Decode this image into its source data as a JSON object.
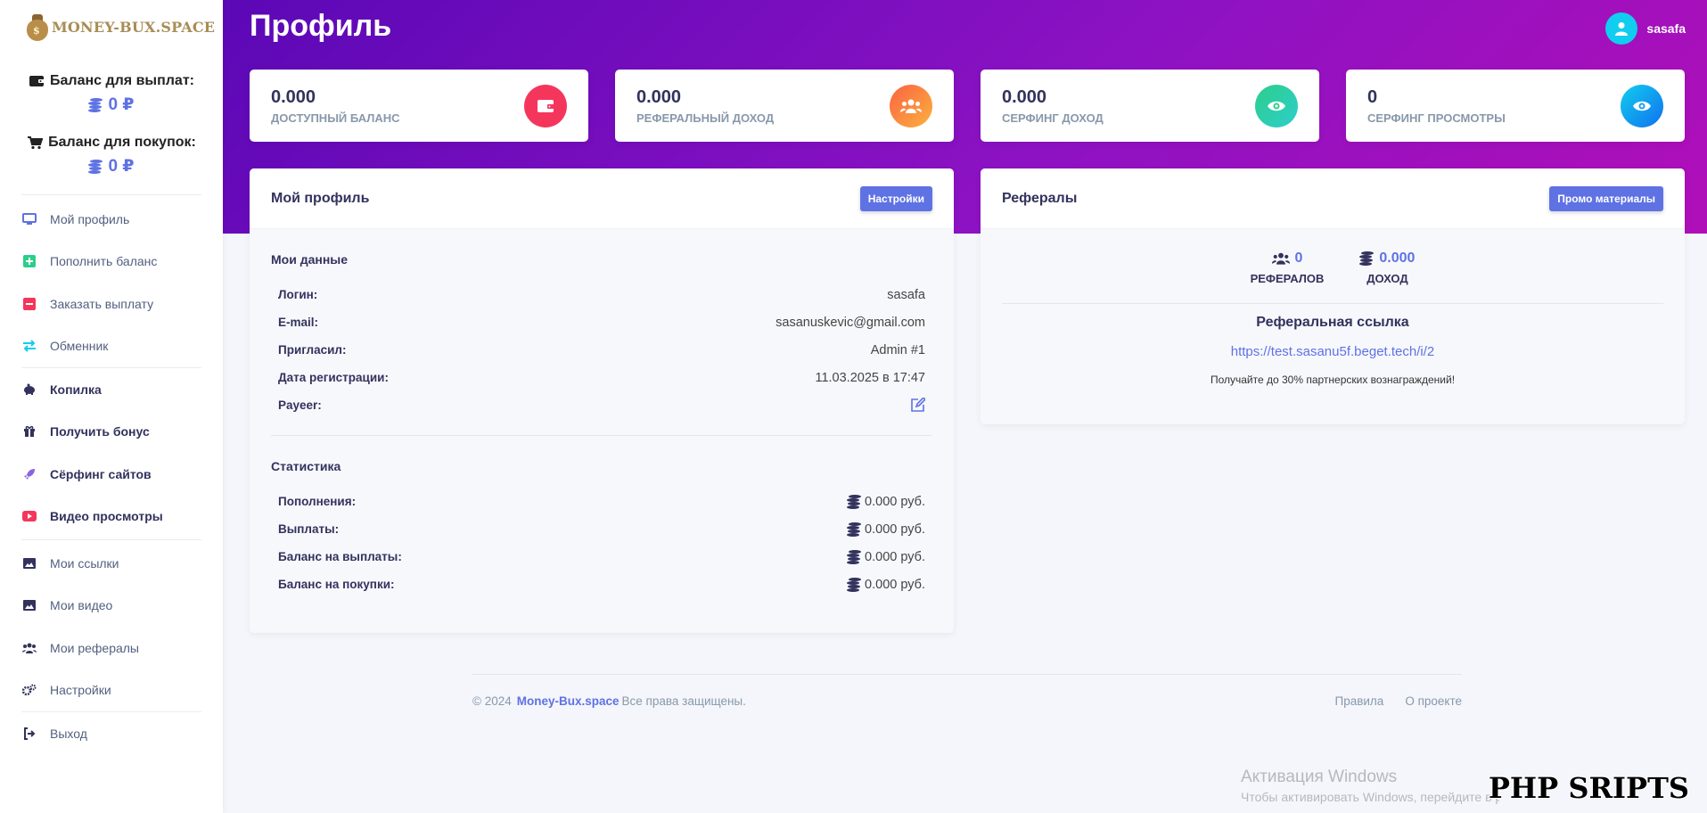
{
  "sidebar": {
    "logo_text": "MONEY-BUX.SPACE",
    "logo_mark": "$",
    "payout_balance_label": "Баланс для выплат:",
    "payout_balance_value": "0 ₽",
    "purchase_balance_label": "Баланс для покупок:",
    "purchase_balance_value": "0 ₽",
    "nav_group1": [
      {
        "label": "Мой профиль",
        "icon": "monitor-icon"
      },
      {
        "label": "Пополнить баланс",
        "icon": "plus-square-icon"
      },
      {
        "label": "Заказать выплату",
        "icon": "minus-square-icon"
      },
      {
        "label": "Обменник",
        "icon": "exchange-icon"
      }
    ],
    "nav_group2": [
      {
        "label": "Копилка",
        "icon": "piggy-bank-icon"
      },
      {
        "label": "Получить бонус",
        "icon": "gift-icon"
      },
      {
        "label": "Сёрфинг сайтов",
        "icon": "rocket-icon"
      },
      {
        "label": "Видео просмотры",
        "icon": "youtube-icon"
      }
    ],
    "nav_group3": [
      {
        "label": "Мои ссылки",
        "icon": "image-icon"
      },
      {
        "label": "Мои видео",
        "icon": "image-icon"
      },
      {
        "label": "Мои рефералы",
        "icon": "users-icon"
      },
      {
        "label": "Настройки",
        "icon": "cogs-icon"
      }
    ],
    "nav_group4": [
      {
        "label": "Выход",
        "icon": "sign-out-icon"
      }
    ]
  },
  "header": {
    "title": "Профиль",
    "username": "sasafa"
  },
  "stats": [
    {
      "value": "0.000",
      "label": "Доступный баланс",
      "icon": "wallet-icon",
      "color": "#f5365c"
    },
    {
      "value": "0.000",
      "label": "Реферальный доход",
      "icon": "users-icon",
      "color": "#fb6340"
    },
    {
      "value": "0.000",
      "label": "Серфинг доход",
      "icon": "eye-icon",
      "color": "#2dce89"
    },
    {
      "value": "0",
      "label": "Серфинг просмотры",
      "icon": "eye-icon",
      "color": "#11cdef"
    }
  ],
  "profile": {
    "title": "Мой профиль",
    "settings_button": "Настройки",
    "data_heading": "Мои данные",
    "fields": [
      {
        "key": "Логин:",
        "value": "sasafa"
      },
      {
        "key": "E-mail:",
        "value": "sasanuskevic@gmail.com"
      },
      {
        "key": "Пригласил:",
        "value": "Admin #1"
      },
      {
        "key": "Дата регистрации:",
        "value": "11.03.2025 в 17:47"
      },
      {
        "key": "Payeer:",
        "value": ""
      }
    ],
    "stats_heading": "Статистика",
    "stats": [
      {
        "key": "Пополнения:",
        "value": "0.000 руб."
      },
      {
        "key": "Выплаты:",
        "value": "0.000 руб."
      },
      {
        "key": "Баланс на выплаты:",
        "value": "0.000 руб."
      },
      {
        "key": "Баланс на покупки:",
        "value": "0.000 руб."
      }
    ]
  },
  "referrals": {
    "title": "Рефералы",
    "promo_button": "Промо материалы",
    "count": "0",
    "count_label": "Рефералов",
    "income": "0.000",
    "income_label": "Доход",
    "link_title": "Реферальная ссылка",
    "link": "https://test.sasanu5f.beget.tech/i/2",
    "note": "Получайте до 30% партнерских вознаграждений!"
  },
  "footer": {
    "copyright": "© 2024",
    "brand": "Money-Bux.space",
    "rights": "Все права защищены.",
    "links": [
      "Правила",
      "О проекте"
    ]
  },
  "overlay": {
    "win_title": "Активация Windows",
    "win_sub": "Чтобы активировать Windows, перейдите в раздел",
    "watermark": "PHP SRIPTS"
  },
  "colors": {
    "accent": "#5e72e4",
    "gradient_start": "#5b08b6",
    "gradient_end": "#b00fb8"
  }
}
